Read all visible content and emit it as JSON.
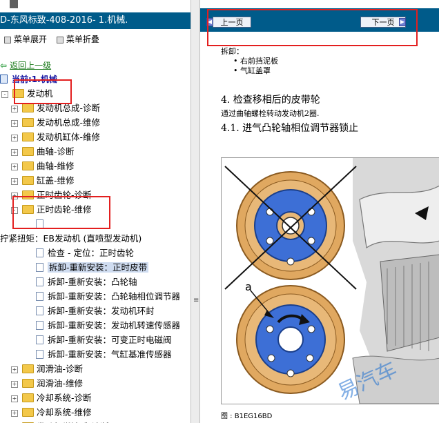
{
  "left_panel": {
    "title": "D-东风标致-408-2016- 1.机械.",
    "menu": {
      "expand": "菜单展开",
      "collapse": "菜单折叠"
    },
    "back_link": "返回上一级",
    "current_label": "当前:1.机械",
    "tree": [
      {
        "label": "发动机",
        "level": 0,
        "type": "folder",
        "expander": "-"
      },
      {
        "label": "发动机总成-诊断",
        "level": 1,
        "type": "folder",
        "expander": "+"
      },
      {
        "label": "发动机总成-维修",
        "level": 1,
        "type": "folder",
        "expander": "+"
      },
      {
        "label": "发动机缸体-维修",
        "level": 1,
        "type": "folder",
        "expander": "+"
      },
      {
        "label": "曲轴-诊断",
        "level": 1,
        "type": "folder",
        "expander": "+"
      },
      {
        "label": "曲轴-维修",
        "level": 1,
        "type": "folder",
        "expander": "+"
      },
      {
        "label": "缸盖-维修",
        "level": 1,
        "type": "folder",
        "expander": "+"
      },
      {
        "label": "正时齿轮-诊断",
        "level": 1,
        "type": "folder",
        "expander": "+"
      },
      {
        "label": "正时齿轮-维修",
        "level": 1,
        "type": "folder",
        "expander": "-"
      },
      {
        "label": "",
        "level": 2,
        "type": "doc"
      },
      {
        "label": "拧紧扭矩：EB发动机 (直喷型发动机)",
        "level": -1,
        "type": "text"
      },
      {
        "label": "检查 - 定位：正时齿轮",
        "level": 2,
        "type": "doc"
      },
      {
        "label": "拆卸-重新安装：正时皮带",
        "level": 2,
        "type": "doc",
        "selected": true
      },
      {
        "label": "拆卸-重新安装：凸轮轴",
        "level": 2,
        "type": "doc"
      },
      {
        "label": "拆卸-重新安装：凸轮轴相位调节器",
        "level": 2,
        "type": "doc"
      },
      {
        "label": "拆卸-重新安装：发动机环封",
        "level": 2,
        "type": "doc"
      },
      {
        "label": "拆卸-重新安装：发动机转速传感器",
        "level": 2,
        "type": "doc"
      },
      {
        "label": "拆卸-重新安装：可变正时电磁阀",
        "level": 2,
        "type": "doc"
      },
      {
        "label": "拆卸-重新安装：气缸基准传感器",
        "level": 2,
        "type": "doc"
      },
      {
        "label": "润滑油-诊断",
        "level": 1,
        "type": "folder",
        "expander": "+"
      },
      {
        "label": "润滑油-维修",
        "level": 1,
        "type": "folder",
        "expander": "+"
      },
      {
        "label": "冷却系统-诊断",
        "level": 1,
        "type": "folder",
        "expander": "+"
      },
      {
        "label": "冷却系统-维修",
        "level": 1,
        "type": "folder",
        "expander": "+"
      },
      {
        "label": "发动机燃油系-诊断",
        "level": 1,
        "type": "folder",
        "expander": "+"
      }
    ]
  },
  "right_panel": {
    "prev_button": "上一页",
    "next_button": "下一页",
    "removal_label": "拆卸：",
    "bullets": [
      "右前挡泥板",
      "气缸盖罩"
    ],
    "step_heading": "4.  检查移相后的皮带轮",
    "step_text": "通过曲轴螺栓转动发动机2圈.",
    "substep_heading": "4.1.  进气凸轮轴相位调节器锁止",
    "figure_label_a": "a",
    "caption": "图 : B1EG16BD"
  },
  "colors": {
    "title_bar": "#005b8a",
    "highlight_red": "#e31f1f",
    "selected_bg": "#cfdcf0",
    "gear": "#e0a860",
    "gear_blue": "#3d6fd6"
  }
}
